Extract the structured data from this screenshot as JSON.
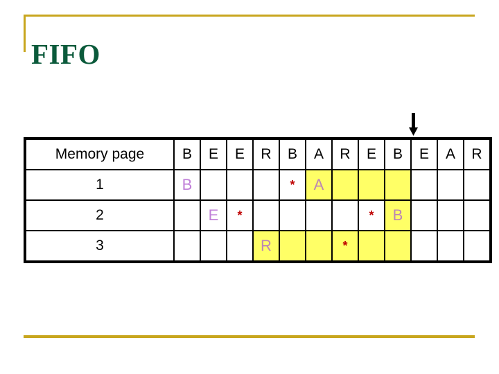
{
  "slide": {
    "title": "FIFO",
    "accent_color": "#C8A61E",
    "title_color": "#0B5A3B"
  },
  "arrow": {
    "icon": "down-arrow-icon",
    "points_to_column_index": 9,
    "color": "#000000"
  },
  "table": {
    "label_header": "Memory page",
    "reference_string": [
      "B",
      "E",
      "E",
      "R",
      "B",
      "A",
      "R",
      "E",
      "B",
      "E",
      "A",
      "R"
    ],
    "highlight_color": "#FFFF66",
    "letter_color": "#C07FD8",
    "star_color": "#BE0000",
    "star_glyph": "*",
    "rows": [
      {
        "label": "1",
        "cells": [
          {
            "text": "B",
            "kind": "letter",
            "highlight": false
          },
          {
            "text": "",
            "kind": "empty",
            "highlight": false
          },
          {
            "text": "",
            "kind": "empty",
            "highlight": false
          },
          {
            "text": "",
            "kind": "empty",
            "highlight": false
          },
          {
            "text": "*",
            "kind": "star",
            "highlight": false
          },
          {
            "text": "A",
            "kind": "letter",
            "highlight": true
          },
          {
            "text": "",
            "kind": "empty",
            "highlight": true
          },
          {
            "text": "",
            "kind": "empty",
            "highlight": true
          },
          {
            "text": "",
            "kind": "empty",
            "highlight": true
          },
          {
            "text": "",
            "kind": "empty",
            "highlight": false
          },
          {
            "text": "",
            "kind": "empty",
            "highlight": false
          },
          {
            "text": "",
            "kind": "empty",
            "highlight": false
          }
        ]
      },
      {
        "label": "2",
        "cells": [
          {
            "text": "",
            "kind": "empty",
            "highlight": false
          },
          {
            "text": "E",
            "kind": "letter",
            "highlight": false
          },
          {
            "text": "*",
            "kind": "star",
            "highlight": false
          },
          {
            "text": "",
            "kind": "empty",
            "highlight": false
          },
          {
            "text": "",
            "kind": "empty",
            "highlight": false
          },
          {
            "text": "",
            "kind": "empty",
            "highlight": false
          },
          {
            "text": "",
            "kind": "empty",
            "highlight": false
          },
          {
            "text": "*",
            "kind": "star",
            "highlight": false
          },
          {
            "text": "B",
            "kind": "letter",
            "highlight": true
          },
          {
            "text": "",
            "kind": "empty",
            "highlight": false
          },
          {
            "text": "",
            "kind": "empty",
            "highlight": false
          },
          {
            "text": "",
            "kind": "empty",
            "highlight": false
          }
        ]
      },
      {
        "label": "3",
        "cells": [
          {
            "text": "",
            "kind": "empty",
            "highlight": false
          },
          {
            "text": "",
            "kind": "empty",
            "highlight": false
          },
          {
            "text": "",
            "kind": "empty",
            "highlight": false
          },
          {
            "text": "R",
            "kind": "letter",
            "highlight": true
          },
          {
            "text": "",
            "kind": "empty",
            "highlight": true
          },
          {
            "text": "",
            "kind": "empty",
            "highlight": true
          },
          {
            "text": "*",
            "kind": "star",
            "highlight": true
          },
          {
            "text": "",
            "kind": "empty",
            "highlight": true
          },
          {
            "text": "",
            "kind": "empty",
            "highlight": true
          },
          {
            "text": "",
            "kind": "empty",
            "highlight": false
          },
          {
            "text": "",
            "kind": "empty",
            "highlight": false
          },
          {
            "text": "",
            "kind": "empty",
            "highlight": false
          }
        ]
      }
    ]
  }
}
